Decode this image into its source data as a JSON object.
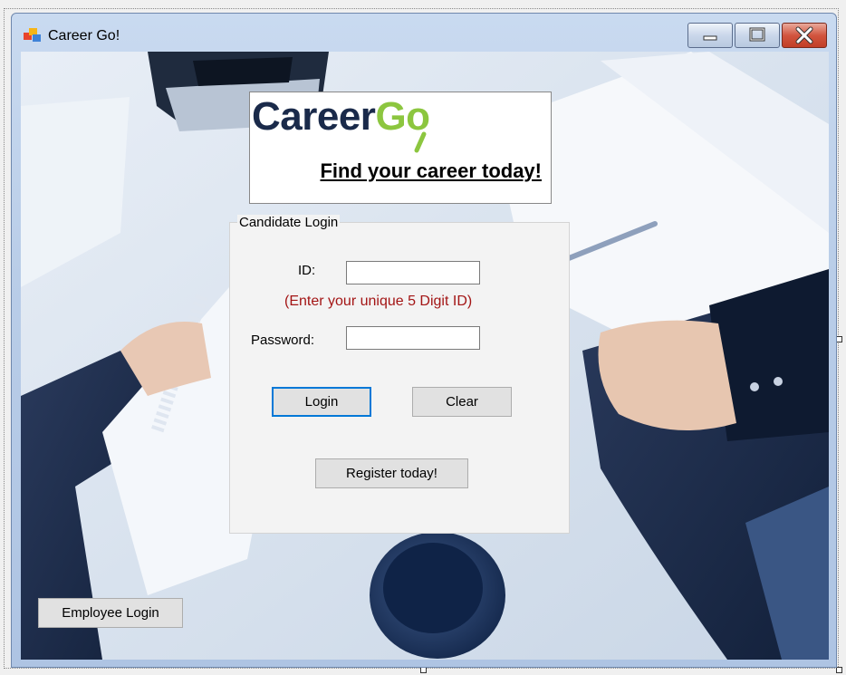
{
  "window": {
    "title": "Career Go!",
    "icon": "windows-forms-app-icon",
    "caption_buttons": [
      "minimize-icon",
      "maximize-icon",
      "close-icon"
    ]
  },
  "logo": {
    "word_part1": "Career",
    "word_part2": "Go",
    "tagline": "Find your career today!",
    "colors": {
      "dark": "#1a2a4a",
      "green": "#8cc63f"
    }
  },
  "candidate_login": {
    "group_title": "Candidate Login",
    "id_label": "ID:",
    "id_value": "",
    "id_hint": "(Enter your unique 5 Digit ID)",
    "password_label": "Password:",
    "password_value": "",
    "login_button": "Login",
    "clear_button": "Clear",
    "register_button": "Register today!"
  },
  "employee_login_button": "Employee Login"
}
